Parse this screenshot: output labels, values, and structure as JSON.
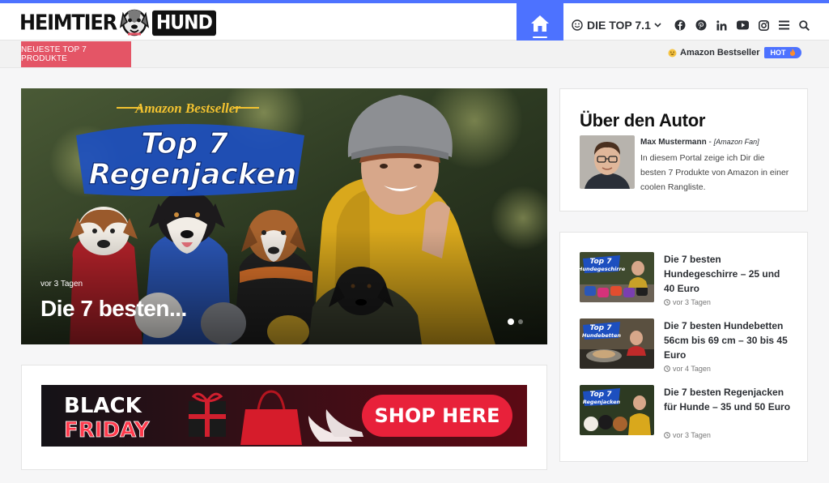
{
  "site": {
    "logo_left": "HEIMTIER",
    "logo_right": "HUND"
  },
  "colors": {
    "accent": "#4d72ff",
    "breaking": "#e45566",
    "text": "#2c2f34"
  },
  "nav": {
    "home_icon": "home-icon",
    "top_label": "DIE TOP 7.1",
    "icons": [
      "facebook-icon",
      "pinterest-icon",
      "linkedin-icon",
      "youtube-icon",
      "instagram-icon",
      "menu-icon",
      "search-icon"
    ]
  },
  "breaking": {
    "label": "NEUESTE TOP 7 PRODUKTE",
    "ticker_text": "Amazon Bestseller",
    "badge": "HOT"
  },
  "hero": {
    "overlay_top": "Amazon Bestseller",
    "overlay_line1": "Top 7",
    "overlay_line2": "Regenjacken",
    "meta": "vor 3 Tagen",
    "title": "Die 7 besten..."
  },
  "ad": {
    "line1": "BLACK",
    "line2": "FRIDAY",
    "cta": "SHOP HERE"
  },
  "author": {
    "heading": "Über den Autor",
    "name": "Max Mustermann",
    "separator": " - ",
    "role": "[Amazon Fan]",
    "bio": "In diesem Portal zeige ich Dir die besten 7 Produkte von Amazon in einer coolen Rangliste."
  },
  "posts": [
    {
      "thumb_line1": "Top 7",
      "thumb_line2": "Hundegeschirre",
      "title": "Die 7 besten Hundegeschirre – 25 und 40 Euro",
      "meta": "vor 3 Tagen"
    },
    {
      "thumb_line1": "Top 7",
      "thumb_line2": "Hundebetten",
      "title": "Die 7 besten Hundebetten 56cm bis 69 cm – 30 bis 45 Euro",
      "meta": "vor 4 Tagen"
    },
    {
      "thumb_line1": "Top 7",
      "thumb_line2": "Regenjacken",
      "title": "Die 7 besten Regenjacken für Hunde – 35 und 50 Euro",
      "meta": "vor 3 Tagen"
    }
  ]
}
